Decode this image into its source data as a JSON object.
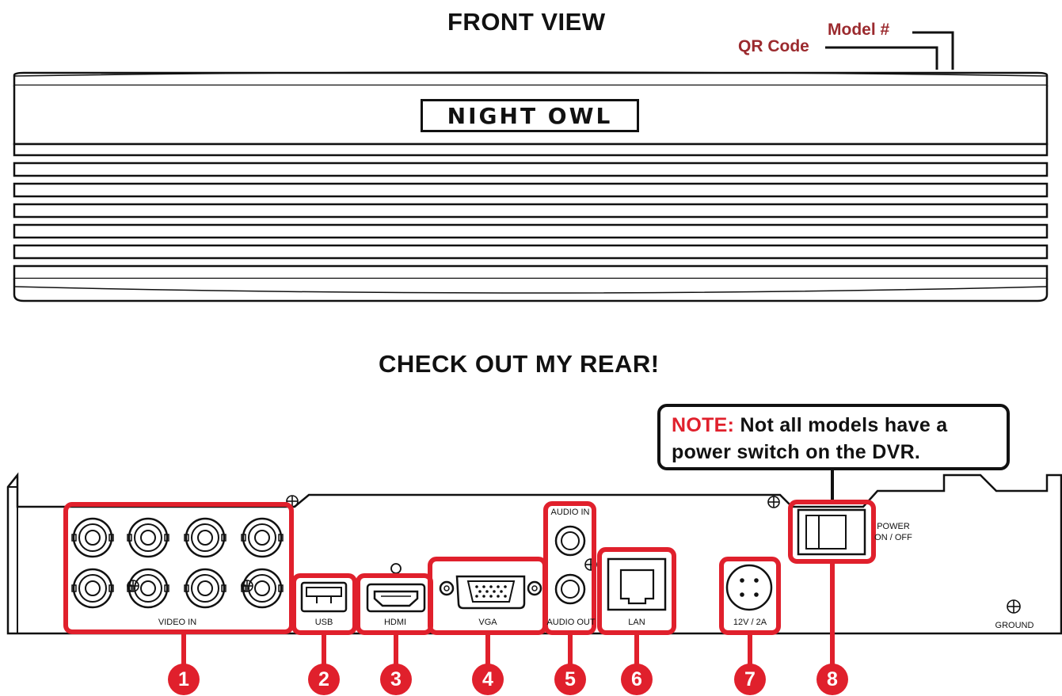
{
  "front": {
    "heading": "FRONT VIEW",
    "logo_text": "NIGHT OWL",
    "model_label": "Model #",
    "qr_label": "QR Code"
  },
  "rear": {
    "heading": "CHECK OUT MY REAR!",
    "note_prefix": "NOTE:",
    "note_text": " Not all models have a power switch on the DVR.",
    "labels": {
      "video_in": "VIDEO IN",
      "usb": "USB",
      "hdmi": "HDMI",
      "vga": "VGA",
      "audio_in": "AUDIO IN",
      "audio_out": "AUDIO OUT",
      "lan": "LAN",
      "power_input": "12V / 2A",
      "power_line1": "POWER",
      "power_line2": "ON / OFF",
      "ground": "GROUND"
    },
    "badges": [
      "1",
      "2",
      "3",
      "4",
      "5",
      "6",
      "7",
      "8"
    ]
  },
  "colors": {
    "callout": "#9b2a2e",
    "highlight": "#e0202c",
    "line": "#111111"
  }
}
